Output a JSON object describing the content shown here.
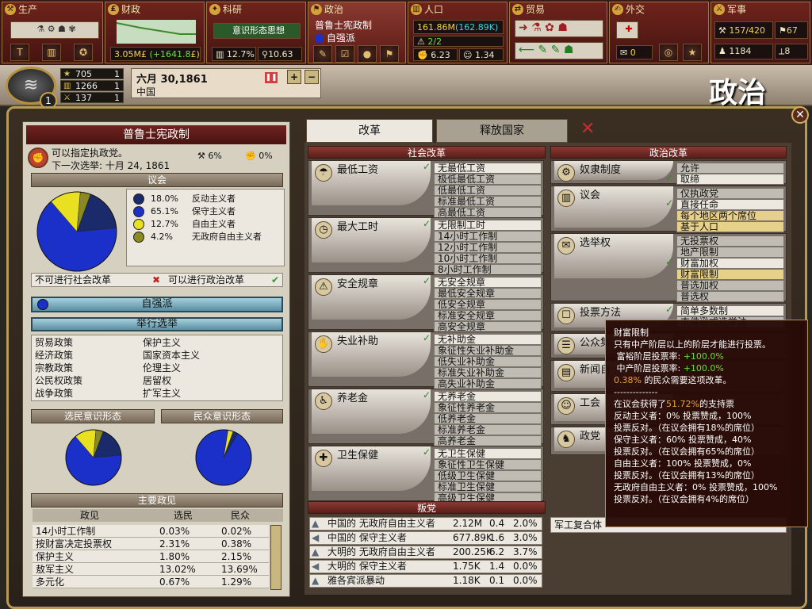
{
  "topbar": {
    "production": {
      "title": "生产"
    },
    "finance": {
      "title": "财政",
      "money": "3.05M",
      "currency": "£",
      "delta": "(+1641.8",
      "delta_currency": "£)"
    },
    "research": {
      "title": "科研",
      "current": "意识形态思想",
      "literacy": "12.7%",
      "points": "10.63"
    },
    "politics": {
      "title": "政治",
      "government": "普鲁士宪政制",
      "party": "自强派"
    },
    "population": {
      "title": "人口",
      "total": "161.86M",
      "growth": "(162.89K)",
      "ratio": "2/2",
      "militancy": "6.23",
      "consciousness": "1.34"
    },
    "trade": {
      "title": "贸易"
    },
    "diplomacy": {
      "title": "外交",
      "count": "0"
    },
    "military": {
      "title": "军事",
      "leaders": "157/420",
      "forces": "67",
      "brigades": "1184",
      "mobilize": "8"
    }
  },
  "nation": {
    "prestige": "705",
    "prestige_rank": "1",
    "industry": "1266",
    "industry_rank": "1",
    "military": "137",
    "military_rank": "1",
    "overall_rank": "1",
    "date": "六月 30, 1861",
    "date_month": "六月",
    "date_day": "30,1861",
    "country": "中国",
    "page_title": "政治"
  },
  "left": {
    "government": "普鲁士宪政制",
    "can_choose_party": "可以指定执政党。",
    "next_election": "下一次选举: 十月 24, 1861",
    "stat_a": "6%",
    "stat_b": "0%",
    "parliament_title": "议会",
    "parliament": [
      {
        "pct": "18.0%",
        "name": "反动主义者",
        "color": "#1a2a6a"
      },
      {
        "pct": "65.1%",
        "name": "保守主义者",
        "color": "#1a30c8"
      },
      {
        "pct": "12.7%",
        "name": "自由主义者",
        "color": "#e8e020"
      },
      {
        "pct": "4.2%",
        "name": "无政府自由主义者",
        "color": "#8a8a20"
      }
    ],
    "no_social": "不可进行社会改革",
    "yes_political": "可以进行政治改革",
    "ruling_party": "自强派",
    "hold_election": "举行选举",
    "policies": [
      {
        "k": "贸易政策",
        "v": "保护主义"
      },
      {
        "k": "经济政策",
        "v": "国家资本主义"
      },
      {
        "k": "宗教政策",
        "v": "伦理主义"
      },
      {
        "k": "公民权政策",
        "v": "居留权"
      },
      {
        "k": "战争政策",
        "v": "扩军主义"
      }
    ],
    "voter_ideology": "选民意识形态",
    "people_ideology": "民众意识形态",
    "issues_title": "主要政见",
    "issue_headers": {
      "name": "政见",
      "voters": "选民",
      "people": "民众"
    },
    "issues": [
      {
        "n": "14小时工作制",
        "v": "0.03%",
        "p": "0.02%"
      },
      {
        "n": "按财富决定投票权",
        "v": "2.31%",
        "p": "0.38%"
      },
      {
        "n": "保护主义",
        "v": "1.80%",
        "p": "2.15%"
      },
      {
        "n": "敖军主义",
        "v": "13.02%",
        "p": "13.69%"
      },
      {
        "n": "多元化",
        "v": "0.67%",
        "p": "1.29%"
      }
    ]
  },
  "tabs": {
    "reforms": "改革",
    "release": "释放国家"
  },
  "social": {
    "title": "社会改革",
    "groups": [
      {
        "name": "最低工资",
        "icon": "☂",
        "options": [
          "无最低工资",
          "极低最低工资",
          "低最低工资",
          "标准最低工资",
          "高最低工资"
        ],
        "sel": 0
      },
      {
        "name": "最大工时",
        "icon": "◷",
        "options": [
          "无限制工时",
          "14小时工作制",
          "12小时工作制",
          "10小时工作制",
          "8小时工作制"
        ],
        "sel": 0
      },
      {
        "name": "安全规章",
        "icon": "⚠",
        "options": [
          "无安全规章",
          "最低安全规章",
          "低安全规章",
          "标准安全规章",
          "高安全规章"
        ],
        "sel": 0
      },
      {
        "name": "失业补助",
        "icon": "✋",
        "options": [
          "无补助金",
          "象征性失业补助金",
          "低失业补助金",
          "标准失业补助金",
          "高失业补助金"
        ],
        "sel": 0
      },
      {
        "name": "养老金",
        "icon": "♿",
        "options": [
          "无养老金",
          "象征性养老金",
          "低养老金",
          "标准养老金",
          "高养老金"
        ],
        "sel": 0
      },
      {
        "name": "卫生保健",
        "icon": "✚",
        "options": [
          "无卫生保健",
          "象征性卫生保健",
          "低级卫生保健",
          "标准卫生保健",
          "高级卫生保健"
        ],
        "sel": 0
      }
    ]
  },
  "political": {
    "title": "政治改革",
    "groups": [
      {
        "name": "奴隶制度",
        "icon": "⚙",
        "options": [
          "允许",
          "取缔"
        ],
        "sel": 1
      },
      {
        "name": "议会",
        "icon": "▥",
        "options": [
          "仅执政党",
          "直接任命",
          "每个地区两个席位",
          "基于人口"
        ],
        "sel": 1,
        "hi": [
          2,
          3
        ]
      },
      {
        "name": "选举权",
        "icon": "✉",
        "options": [
          "无投票权",
          "地产限制",
          "财富加权",
          "财富限制",
          "普选加权",
          "普选权"
        ],
        "sel": 2,
        "hi": [
          3
        ]
      },
      {
        "name": "投票方法",
        "icon": "☐",
        "options": [
          "简单多数制",
          "杰佛逊式选举法"
        ],
        "sel": 0
      },
      {
        "name": "公众集",
        "icon": "☰"
      },
      {
        "name": "新闻自",
        "icon": "▤"
      },
      {
        "name": "工会",
        "icon": "☺"
      },
      {
        "name": "政党",
        "icon": "♞"
      }
    ]
  },
  "rebels": {
    "title": "叛党",
    "rows": [
      {
        "icon": "▲",
        "name": "中国的 无政府自由主义者",
        "size": "2.12M",
        "a": "0.4",
        "b": "2.0%"
      },
      {
        "icon": "◀",
        "name": "中国的 保守主义者",
        "size": "677.89K",
        "a": "1.6",
        "b": "3.0%"
      },
      {
        "icon": "▲",
        "name": "大明的 无政府自由主义者",
        "size": "200.25K",
        "a": "6.2",
        "b": "3.7%"
      },
      {
        "icon": "◀",
        "name": "大明的 保守主义者",
        "size": "1.75K",
        "a": "1.4",
        "b": "0.0%"
      },
      {
        "icon": "▲",
        "name": "雅各宾派暴动",
        "size": "1.18K",
        "a": "0.1",
        "b": "0.0%"
      }
    ]
  },
  "right_bottom_label": "军工复合体",
  "tooltip": {
    "title": "财富限制",
    "desc": "只有中产阶层以上的阶层才能进行投票。",
    "rich_label": "富裕阶层投票率:",
    "rich_val": "+100.0%",
    "middle_label": "中产阶层投票率:",
    "middle_val": "+100.0%",
    "support_pct": "0.38%",
    "support_text": "的民众需要这项改革。",
    "sep": "--------------",
    "parl_prefix": "在议会获得了",
    "parl_pct": "51.72%",
    "parl_suffix": "的支持票",
    "l1": "反动主义者：0% 投票赞成，100%",
    "l2": "投票反对。（在议会拥有18%的席位）",
    "l3": "保守主义者：60% 投票赞成，40%",
    "l4": "投票反对。（在议会拥有65%的席位）",
    "l5": "自由主义者：100% 投票赞成，0%",
    "l6": "投票反对。（在议会拥有13%的席位）",
    "l7": "无政府自由主义者：0% 投票赞成，100%",
    "l8": "投票反对。（在议会拥有4%的席位）"
  },
  "chart_data": [
    {
      "type": "pie",
      "title": "议会",
      "values": [
        18.0,
        65.1,
        12.7,
        4.2
      ],
      "categories": [
        "反动主义者",
        "保守主义者",
        "自由主义者",
        "无政府自由主义者"
      ],
      "colors": [
        "#1a2a6a",
        "#1a30c8",
        "#e8e020",
        "#8a8a20"
      ]
    },
    {
      "type": "pie",
      "title": "选民意识形态",
      "values": [
        18.0,
        65.1,
        12.7,
        4.2
      ],
      "colors": [
        "#1a2a6a",
        "#1a30c8",
        "#e8e020",
        "#8a8a20"
      ]
    },
    {
      "type": "pie",
      "title": "民众意识形态",
      "values": [
        3,
        94,
        3
      ],
      "colors": [
        "#1a2a6a",
        "#1a30c8",
        "#e8e020"
      ]
    }
  ]
}
